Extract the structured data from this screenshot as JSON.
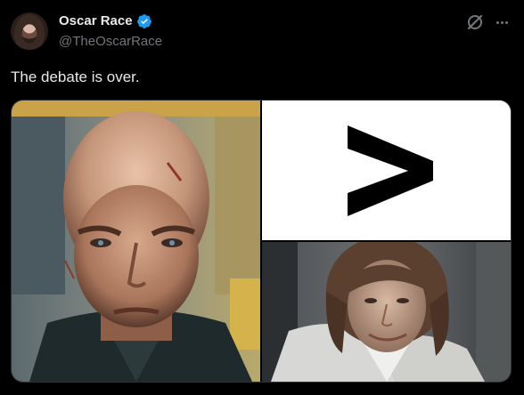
{
  "post": {
    "author": {
      "display_name": "Oscar Race",
      "handle": "@TheOscarRace",
      "verified": true,
      "verified_badge_color": "#1d9bf0",
      "avatar_icon": "avatar"
    },
    "actions": {
      "grok_icon": "grok-icon",
      "more_icon": "more-icon"
    },
    "text": "The debate is over.",
    "media": [
      {
        "name": "bald-man-photo"
      },
      {
        "name": "greater-than-symbol-image"
      },
      {
        "name": "long-haired-man-photo"
      }
    ]
  },
  "colors": {
    "background": "#000000",
    "primary_text": "#e7e9ea",
    "secondary_text": "#71767b"
  }
}
